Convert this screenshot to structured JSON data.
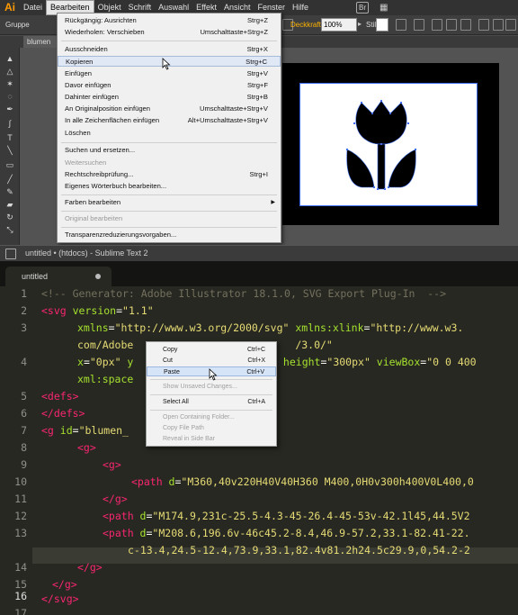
{
  "illustrator": {
    "logo": "Ai",
    "menus": [
      "Datei",
      "Bearbeiten",
      "Objekt",
      "Schrift",
      "Auswahl",
      "Effekt",
      "Ansicht",
      "Fenster",
      "Hilfe"
    ],
    "active_menu": "Bearbeiten",
    "bridge_label": "Br",
    "control": {
      "selection_label": "Gruppe",
      "opacity_label": "Deckkraft:",
      "opacity_value": "100%",
      "style_label": "Stil:"
    },
    "doc_tab": "blumen",
    "edit_menu": [
      {
        "label": "Rückgängig: Ausrichten",
        "shortcut": "Strg+Z"
      },
      {
        "label": "Wiederholen: Verschieben",
        "shortcut": "Umschalttaste+Strg+Z"
      },
      {
        "label": "Ausschneiden",
        "shortcut": "Strg+X"
      },
      {
        "label": "Kopieren",
        "shortcut": "Strg+C"
      },
      {
        "label": "Einfügen",
        "shortcut": "Strg+V"
      },
      {
        "label": "Davor einfügen",
        "shortcut": "Strg+F"
      },
      {
        "label": "Dahinter einfügen",
        "shortcut": "Strg+B"
      },
      {
        "label": "An Originalposition einfügen",
        "shortcut": "Umschalttaste+Strg+V"
      },
      {
        "label": "In alle Zeichenflächen einfügen",
        "shortcut": "Alt+Umschalttaste+Strg+V"
      },
      {
        "label": "Löschen",
        "shortcut": ""
      },
      {
        "label": "Suchen und ersetzen...",
        "shortcut": ""
      },
      {
        "label": "Weitersuchen",
        "shortcut": ""
      },
      {
        "label": "Rechtschreibprüfung...",
        "shortcut": "Strg+I"
      },
      {
        "label": "Eigenes Wörterbuch bearbeiten...",
        "shortcut": ""
      },
      {
        "label": "Farben bearbeiten",
        "shortcut": ""
      },
      {
        "label": "Original bearbeiten",
        "shortcut": ""
      },
      {
        "label": "Transparenzreduzierungsvorgaben...",
        "shortcut": ""
      }
    ]
  },
  "sublime": {
    "window_title": "untitled • (htdocs) - Sublime Text 2",
    "tab_label": "untitled",
    "line_numbers": [
      "1",
      "2",
      "3",
      "4",
      "5",
      "6",
      "7",
      "8",
      "9",
      "10",
      "11",
      "12",
      "13",
      "14",
      "15",
      "16",
      "17",
      "18"
    ],
    "code": {
      "l1": "<!-- Generator: Adobe Illustrator 18.1.0, SVG Export Plug-In  -->",
      "l2_tag": "<svg",
      "l2_attr": " version",
      "l2_eq": "=",
      "l2_val": "\"1.1\"",
      "l3_attr1": "xmlns",
      "l3_val1": "\"http://www.w3.org/2000/svg\"",
      "l3_attr2": " xmlns:xlink",
      "l3_val2": "\"http://www.w3.",
      "l3b": "com/Adobe",
      "l3b_val": "/3.0/\"",
      "l4_attr1": "x",
      "l4_val1": "\"0px\"",
      "l4_attr1b": " y",
      "l4_attr2": " height",
      "l4_val2": "\"300px\"",
      "l4_attr3": " viewBox",
      "l4_val3": "\"0 0 400",
      "l4b_attr": "xml:space",
      "l5": "<defs>",
      "l6": "</defs>",
      "l7_tag": "<g",
      "l7_attr": " id",
      "l7_val": "\"blumen_",
      "l8": "<g>",
      "l9": "<g>",
      "l10_tag": "<path",
      "l10_attr": " d",
      "l10_val": "\"M360,40v220H40V40H360 M400,0H0v300h400V0L400,0",
      "l11": "</g>",
      "l12_tag": "<path",
      "l12_attr": " d",
      "l12_val": "\"M174.9,231c-25.5-4.3-45-26.4-45-53v-42.1l45,44.5V2",
      "l13_tag": "<path",
      "l13_attr": " d",
      "l13_val": "\"M208.6,196.6v-46c45.2-8.4,46.9-57.2,33.1-82.41-22.",
      "l14_val": "c-13.4,24.5-12.4,73.9,33.1,82.4v81.2h24.5c29.9,0,54.2-2",
      "l15": "</g>",
      "l16": "</g>",
      "l17": "</svg>"
    },
    "context_menu": [
      {
        "label": "Copy",
        "shortcut": "Ctrl+C"
      },
      {
        "label": "Cut",
        "shortcut": "Ctrl+X"
      },
      {
        "label": "Paste",
        "shortcut": "Ctrl+V"
      },
      {
        "label": "Show Unsaved Changes...",
        "shortcut": ""
      },
      {
        "label": "Select All",
        "shortcut": "Ctrl+A"
      },
      {
        "label": "Open Containing Folder...",
        "shortcut": ""
      },
      {
        "label": "Copy File Path",
        "shortcut": ""
      },
      {
        "label": "Reveal in Side Bar",
        "shortcut": ""
      }
    ]
  }
}
